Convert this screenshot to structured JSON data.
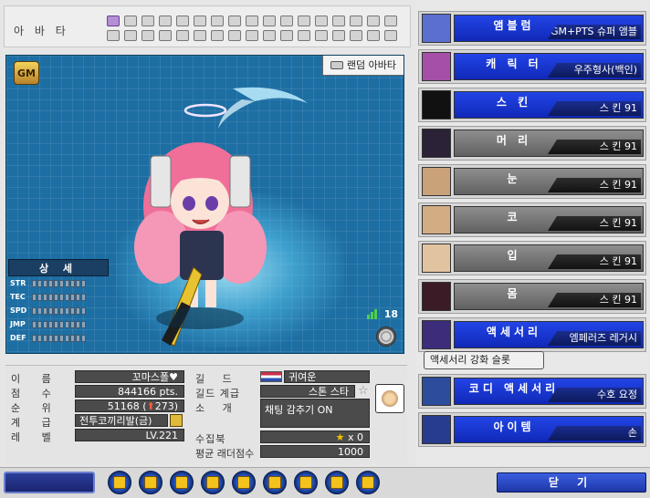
{
  "avatar_header": {
    "title": "아 바 타",
    "slot_rows": [
      [
        true,
        false,
        false,
        false,
        false,
        false,
        false,
        false,
        false,
        false,
        false,
        false,
        false,
        false,
        false,
        false,
        false
      ],
      [
        false,
        false,
        false,
        false,
        false,
        false,
        false,
        false,
        false,
        false,
        false,
        false,
        false,
        false,
        false,
        false,
        false
      ]
    ]
  },
  "avatar_view": {
    "gm_badge": "GM",
    "random_label": "랜덤 아바타",
    "detail_title": "상 세",
    "stats": [
      "STR",
      "TEC",
      "SPD",
      "JMP",
      "DEF"
    ],
    "signal_count": "18"
  },
  "profile": {
    "name_label": "이 름",
    "name": "꼬마스폴♥",
    "score_label": "점 수",
    "score": "844166 pts.",
    "rank_label": "순 위",
    "rank": "51168 (",
    "rank_change": "273)",
    "grade_label": "계 급",
    "grade": "전투코끼리발(금)",
    "level_label": "레 벨",
    "level": "LV.221",
    "guild_label": "길 드",
    "guild": "귀여운",
    "guild_grade_label": "길드 계급",
    "guild_grade": "스톤 스타",
    "intro_label": "소 개",
    "intro": "채팅 감추기 ON",
    "collection_label": "수집북",
    "collection": "x 0",
    "ladder_label": "평균 래더점수",
    "ladder": "1000"
  },
  "categories": [
    {
      "name": "앰블럼",
      "value": "GM+PTS 슈퍼 앰블럼",
      "style": "blue",
      "thumb": "#5a6fd0"
    },
    {
      "name": "캐 릭 터",
      "value": "우주형사(백인)",
      "style": "blue",
      "thumb": "#a64fa8"
    },
    {
      "name": "스  킨",
      "value": "스  킨 91",
      "style": "blue",
      "thumb": "#111111"
    },
    {
      "name": "머 리",
      "value": "스  킨 91",
      "style": "gray",
      "thumb": "#2b2238"
    },
    {
      "name": "눈",
      "value": "스  킨 91",
      "style": "gray",
      "thumb": "#c9a27a"
    },
    {
      "name": "코",
      "value": "스  킨 91",
      "style": "gray",
      "thumb": "#d2ad83"
    },
    {
      "name": "입",
      "value": "스  킨 91",
      "style": "gray",
      "thumb": "#e2c3a0"
    },
    {
      "name": "몸",
      "value": "스  킨 91",
      "style": "gray",
      "thumb": "#3a1b26"
    },
    {
      "name": "액세서리",
      "value": "엠페러즈 레거시",
      "style": "blue",
      "thumb": "#3c2c7a"
    },
    {
      "name": "코디 액세서리",
      "value": "수호 요정",
      "style": "blue",
      "thumb": "#2b4d9c"
    },
    {
      "name": "아이템",
      "value": "손",
      "style": "blue",
      "thumb": "#283c8f"
    }
  ],
  "accessory_slot_label": "액세서리 강화 슬롯",
  "toolbar": {
    "icons": [
      "chat-bubble-icon",
      "emote-icon",
      "box-icon",
      "shield-icon",
      "star-icon",
      "bag-icon",
      "lock-icon",
      "chart-icon",
      "card-icon"
    ]
  },
  "close_label": "닫 기",
  "colors": {
    "accent_blue": "#1f3fd8",
    "panel_gray": "#e6e6e6"
  }
}
